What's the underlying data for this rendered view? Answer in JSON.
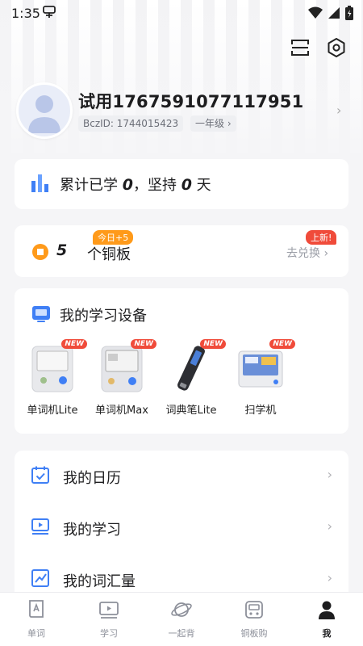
{
  "status_bar": {
    "time": "1:35"
  },
  "profile": {
    "username": "试用1767591077117951",
    "bcz_id": "BczID: 1744015423",
    "grade": "一年级"
  },
  "stats": {
    "prefix": "累计已学 ",
    "learned": "0",
    "middle": "，坚持 ",
    "days": "0",
    "suffix": " 天"
  },
  "coins": {
    "count": "5",
    "label": "个铜板",
    "today_tag": "今日+5",
    "new_tag": "上新!",
    "exchange": "去兑换"
  },
  "devices": {
    "title": "我的学习设备",
    "new_badge": "NEW",
    "items": [
      {
        "label": "单词机Lite"
      },
      {
        "label": "单词机Max"
      },
      {
        "label": "词典笔Lite"
      },
      {
        "label": "扫学机"
      }
    ]
  },
  "menu": [
    {
      "label": "我的日历"
    },
    {
      "label": "我的学习"
    },
    {
      "label": "我的词汇量"
    }
  ],
  "bottom_nav": [
    {
      "label": "单词"
    },
    {
      "label": "学习"
    },
    {
      "label": "一起背"
    },
    {
      "label": "铜板购"
    },
    {
      "label": "我"
    }
  ],
  "colors": {
    "accent_blue": "#3f7ff5",
    "coin_orange": "#ff9a1a",
    "badge_red": "#f04b3a",
    "page_bg": "#f5f5f7"
  }
}
